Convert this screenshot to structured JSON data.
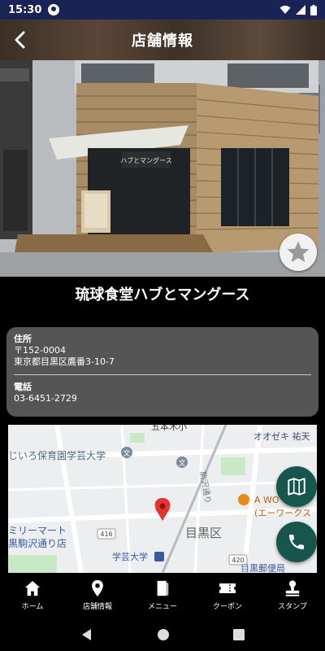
{
  "status_bar": {
    "time": "15:30"
  },
  "header": {
    "title": "店舗情報"
  },
  "photo": {
    "sign_text": "ハブとマングース"
  },
  "shop": {
    "name": "琉球食堂ハブとマングース"
  },
  "info": {
    "address_label": "住所",
    "postal_code": "〒152-0004",
    "address": "東京都目黒区鷹番3-10-7",
    "phone_label": "電話",
    "phone": "03-6451-2729"
  },
  "map": {
    "labels": {
      "top": "五本木小",
      "ozeki": "オオゼキ 祐天",
      "school": "じいろ保育園学芸大学",
      "bun1": "文",
      "bun2": "文",
      "street": "駒沢通り",
      "family": "ミリーマート",
      "family2": "黒駒沢通り店",
      "route": "416",
      "ward": "目黒区",
      "awork": "A WO",
      "awork2": "(エーワークス",
      "station": "学芸大学",
      "route2": "420",
      "post": "目黒郵便局"
    }
  },
  "nav": {
    "items": [
      {
        "label": "ホーム"
      },
      {
        "label": "店舗情報"
      },
      {
        "label": "メニュー"
      },
      {
        "label": "クーポン"
      },
      {
        "label": "スタンプ"
      }
    ]
  }
}
